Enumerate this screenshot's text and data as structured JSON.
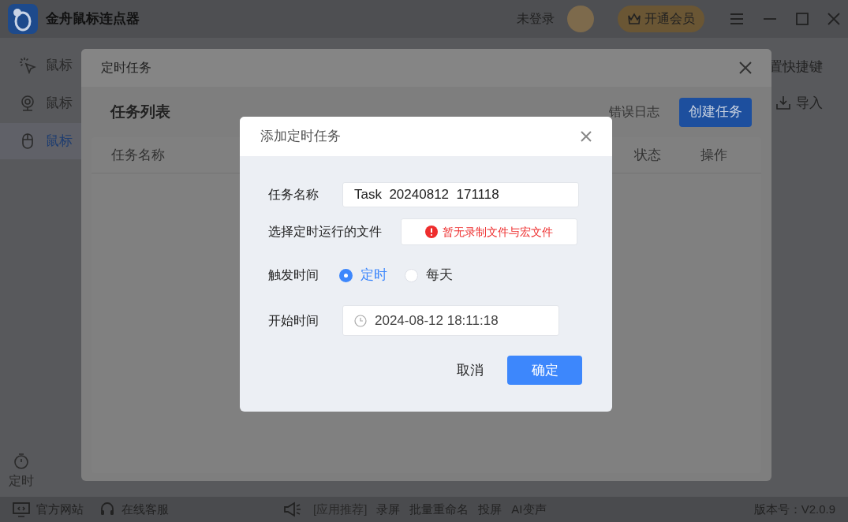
{
  "app": {
    "title": "金舟鼠标连点器",
    "login": "未登录",
    "vip_button": "开通会员"
  },
  "sidebar": {
    "items": [
      {
        "label": "鼠标",
        "selected": false
      },
      {
        "label": "鼠标",
        "selected": false
      },
      {
        "label": "鼠标",
        "selected": true
      }
    ],
    "bottom_items": [
      "定时"
    ]
  },
  "toolbar": {
    "shortcut": "置快捷键",
    "import": "导入"
  },
  "task_dialog": {
    "title": "定时任务",
    "heading": "任务列表",
    "error_log": "错误日志",
    "create_button": "创建任务",
    "columns": [
      "任务名称",
      "状态",
      "操作"
    ]
  },
  "add_dialog": {
    "title": "添加定时任务",
    "name_label": "任务名称",
    "name_value": "Task  20240812  171118",
    "file_label": "选择定时运行的文件",
    "file_message": "暂无录制文件与宏文件",
    "trigger_label": "触发时间",
    "trigger_options": [
      {
        "label": "定时",
        "selected": true
      },
      {
        "label": "每天",
        "selected": false
      }
    ],
    "start_label": "开始时间",
    "start_value": "2024-08-12 18:11:18",
    "cancel_button": "取消",
    "confirm_button": "确定"
  },
  "footer": {
    "links": [
      "官方网站",
      "在线客服"
    ],
    "recommend": [
      "[应用推荐]",
      "录屏",
      "批量重命名",
      "投屏",
      "AI变声"
    ],
    "version": "版本号：V2.0.9"
  }
}
